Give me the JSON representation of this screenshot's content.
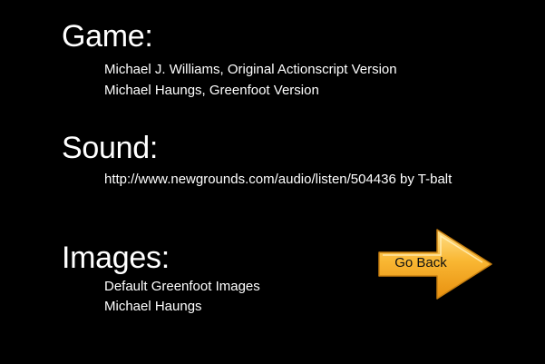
{
  "sections": {
    "game": {
      "heading": "Game:",
      "lines": [
        "Michael J. Williams, Original Actionscript Version",
        "Michael Haungs, Greenfoot Version"
      ]
    },
    "sound": {
      "heading": "Sound:",
      "lines": [
        "http://www.newgrounds.com/audio/listen/504436 by T-balt"
      ]
    },
    "images": {
      "heading": "Images:",
      "lines": [
        "Default Greenfoot Images",
        "Michael Haungs"
      ]
    }
  },
  "go_back_button": {
    "label": "Go Back",
    "icon": "arrow-right-icon",
    "fill_color": "#f7a51c",
    "highlight_color": "#ffe08a",
    "outline_color": "#c77f10"
  },
  "colors": {
    "background": "#000000",
    "text": "#ffffff"
  }
}
